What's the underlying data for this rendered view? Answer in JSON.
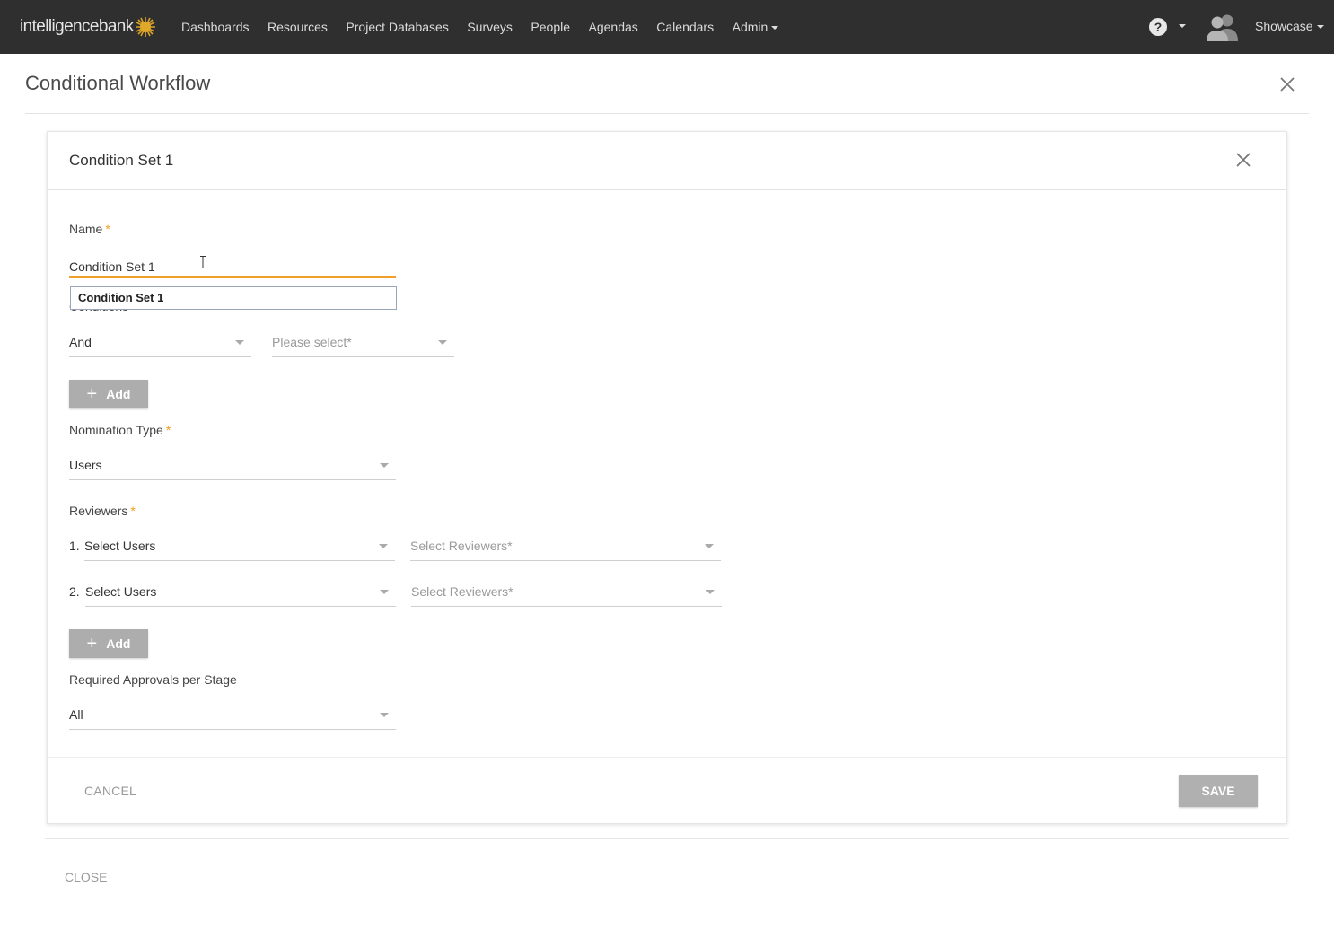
{
  "nav": {
    "logo_text": "intelligencebank",
    "items": [
      "Dashboards",
      "Resources",
      "Project Databases",
      "Surveys",
      "People",
      "Agendas",
      "Calendars"
    ],
    "admin_label": "Admin",
    "user_label": "Showcase",
    "help_glyph": "?",
    "brand_color": "#2f2f2f"
  },
  "page": {
    "title": "Conditional Workflow",
    "close_label": "CLOSE"
  },
  "card": {
    "title": "Condition Set 1",
    "name_label": "Name",
    "required_mark": "*",
    "name_value": "Condition Set 1",
    "autocomplete_suggestion": "Condition Set 1",
    "conditions_label": "Conditions",
    "conditions": {
      "operator": "And",
      "field_placeholder": "Please select*"
    },
    "add_label": "Add",
    "nomination_type_label": "Nomination Type",
    "nomination_type_value": "Users",
    "reviewers_label": "Reviewers",
    "reviewers": [
      {
        "index": "1.",
        "type": "Select Users",
        "reviewers_placeholder": "Select Reviewers*"
      },
      {
        "index": "2.",
        "type": "Select Users",
        "reviewers_placeholder": "Select Reviewers*"
      }
    ],
    "required_approvals_label": "Required Approvals per Stage",
    "required_approvals_value": "All",
    "cancel_label": "CANCEL",
    "save_label": "SAVE",
    "accent_color": "#f0a02a"
  }
}
